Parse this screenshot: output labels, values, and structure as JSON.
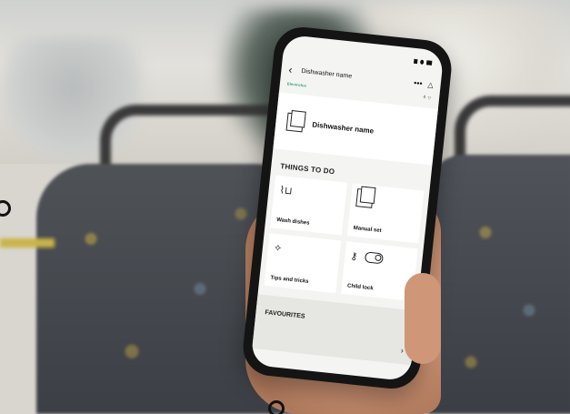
{
  "app": {
    "title": "Dishwasher name",
    "brand": "Electrolux",
    "back_icon": "back-arrow-icon",
    "more_icon": "more-icon",
    "bell_icon": "bell-icon"
  },
  "device": {
    "name": "Dishwasher name"
  },
  "things_to_do": {
    "label": "THINGS TO DO",
    "items": [
      {
        "label": "Wash dishes",
        "icon": "wash-dishes-icon"
      },
      {
        "label": "Manual set",
        "icon": "manual-icon"
      },
      {
        "label": "Tips and tricks",
        "icon": "sparkle-icon"
      },
      {
        "label": "Child lock",
        "icon": "key-icon"
      }
    ]
  },
  "favourites": {
    "label": "FAVOURITES"
  },
  "colors": {
    "brand": "#1a9c77",
    "screen_bg": "#f4f4f2",
    "phone_body": "#141414"
  }
}
